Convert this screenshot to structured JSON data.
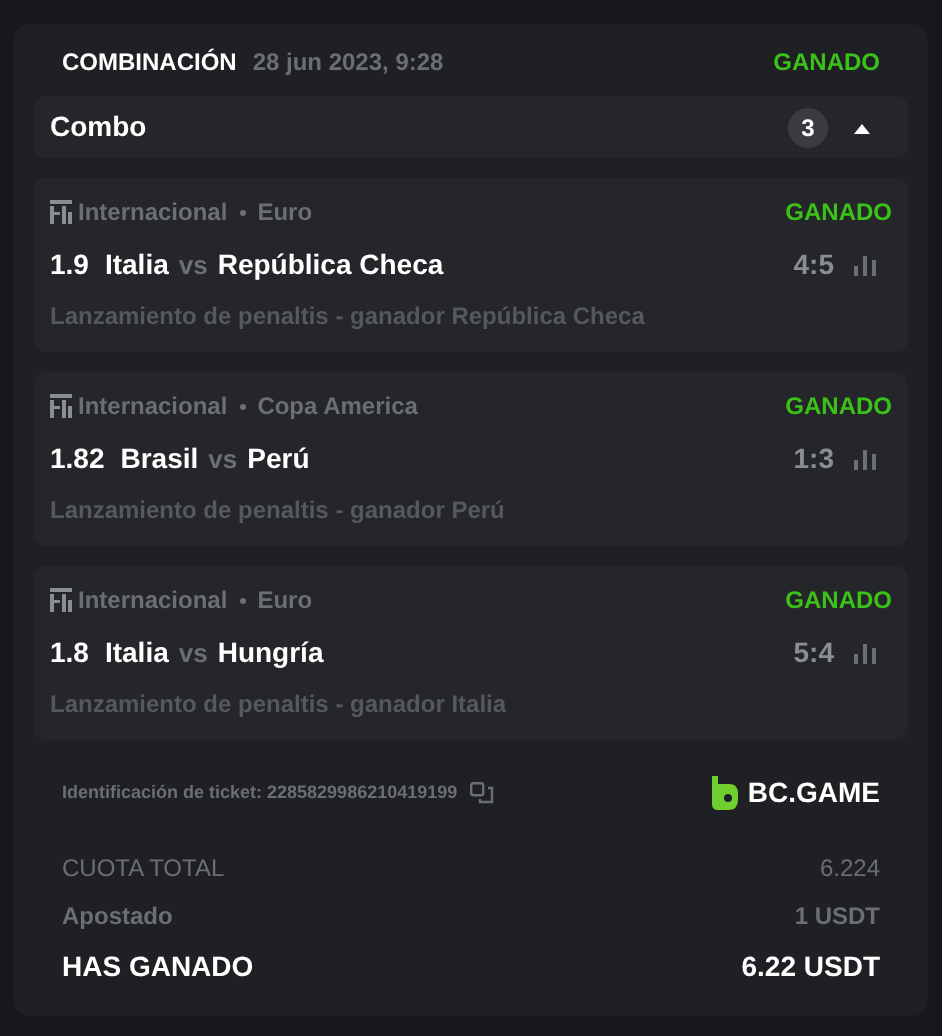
{
  "header": {
    "type": "COMBINACIÓN",
    "date": "28 jun 2023, 9:28",
    "status": "GANADO"
  },
  "combo": {
    "label": "Combo",
    "count": "3",
    "expanded": true
  },
  "matches": [
    {
      "category": "Internacional",
      "league": "Euro",
      "status": "GANADO",
      "odds": "1.9",
      "home": "Italia",
      "vs": "vs",
      "away": "República Checa",
      "score": "4:5",
      "market": "Lanzamiento de penaltis - ganador República Checa"
    },
    {
      "category": "Internacional",
      "league": "Copa America",
      "status": "GANADO",
      "odds": "1.82",
      "home": "Brasil",
      "vs": "vs",
      "away": "Perú",
      "score": "1:3",
      "market": "Lanzamiento de penaltis - ganador Perú"
    },
    {
      "category": "Internacional",
      "league": "Euro",
      "status": "GANADO",
      "odds": "1.8",
      "home": "Italia",
      "vs": "vs",
      "away": "Hungría",
      "score": "5:4",
      "market": "Lanzamiento de penaltis - ganador Italia"
    }
  ],
  "ticket": {
    "label": "Identificación de ticket: 2285829986210419199",
    "brand": "BC.GAME"
  },
  "summary": [
    {
      "kind": "odds",
      "label": "CUOTA TOTAL",
      "value": "6.224"
    },
    {
      "kind": "stake",
      "label": "Apostado",
      "value": "1 USDT"
    },
    {
      "kind": "win",
      "label": "HAS GANADO",
      "value": "6.22 USDT"
    }
  ]
}
